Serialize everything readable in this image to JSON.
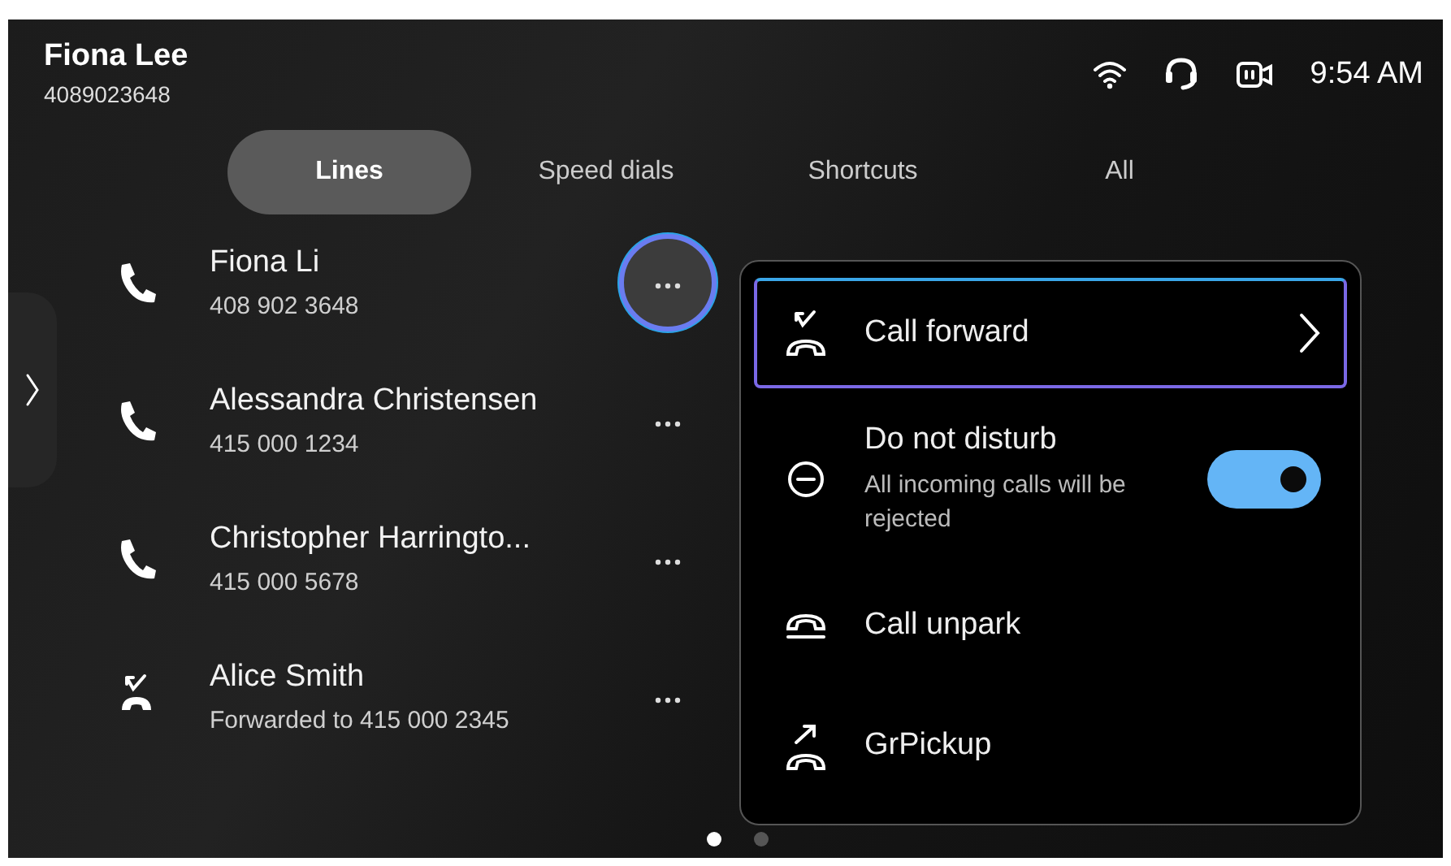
{
  "header": {
    "name": "Fiona Lee",
    "number": "4089023648",
    "time": "9:54 AM"
  },
  "tabs": [
    {
      "label": "Lines",
      "selected": true
    },
    {
      "label": "Speed dials",
      "selected": false
    },
    {
      "label": "Shortcuts",
      "selected": false
    },
    {
      "label": "All",
      "selected": false
    }
  ],
  "lines": [
    {
      "kind": "call",
      "name": "Fiona Li",
      "detail": "408 902 3648",
      "selected": true
    },
    {
      "kind": "call",
      "name": "Alessandra Christensen",
      "detail": "415 000 1234",
      "selected": false
    },
    {
      "kind": "call",
      "name": "Christopher Harringto...",
      "detail": "415 000 5678",
      "selected": false
    },
    {
      "kind": "forwarded",
      "name": "Alice Smith",
      "detail": "Forwarded to 415 000 2345",
      "selected": false
    }
  ],
  "menu": [
    {
      "kind": "forward",
      "label": "Call forward",
      "selected": true
    },
    {
      "kind": "dnd",
      "label": "Do not disturb",
      "description": "All incoming calls will be rejected",
      "on": true,
      "selected": false
    },
    {
      "kind": "unpark",
      "label": "Call unpark",
      "selected": false
    },
    {
      "kind": "pickup",
      "label": "GrPickup",
      "selected": false
    }
  ],
  "page_dots": [
    {
      "selected": true
    },
    {
      "selected": false
    }
  ]
}
